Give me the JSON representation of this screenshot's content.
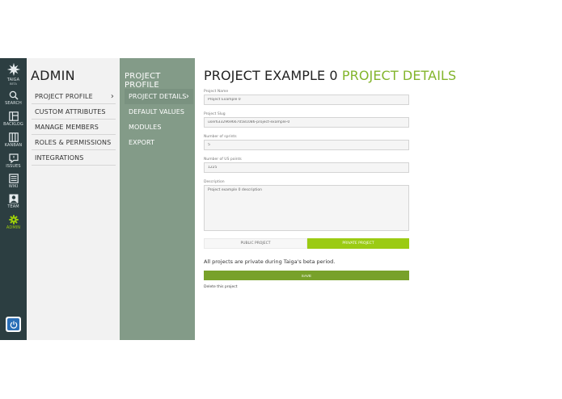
{
  "nav": {
    "brand": "TAIGA",
    "brand_sub": "BETA",
    "items": [
      {
        "label": "SEARCH",
        "icon": "search-icon"
      },
      {
        "label": "BACKLOG",
        "icon": "backlog-icon"
      },
      {
        "label": "KANBAN",
        "icon": "kanban-icon"
      },
      {
        "label": "ISSUES",
        "icon": "issues-icon"
      },
      {
        "label": "WIKI",
        "icon": "wiki-icon"
      },
      {
        "label": "TEAM",
        "icon": "team-icon"
      },
      {
        "label": "ADMIN",
        "icon": "gear-icon"
      }
    ]
  },
  "admin": {
    "title": "ADMIN",
    "items": [
      {
        "label": "PROJECT PROFILE"
      },
      {
        "label": "CUSTOM ATTRIBUTES"
      },
      {
        "label": "MANAGE MEMBERS"
      },
      {
        "label": "ROLES & PERMISSIONS"
      },
      {
        "label": "INTEGRATIONS"
      }
    ]
  },
  "profile": {
    "title": "PROJECT PROFILE",
    "items": [
      {
        "label": "PROJECT DETAILS"
      },
      {
        "label": "DEFAULT VALUES"
      },
      {
        "label": "MODULES"
      },
      {
        "label": "EXPORT"
      }
    ]
  },
  "main": {
    "project_name": "PROJECT EXAMPLE 0",
    "section_title": "PROJECT DETAILS",
    "fields": {
      "name": {
        "label": "Project Name",
        "value": "Project Example 0"
      },
      "slug": {
        "label": "Project Slug",
        "value": "user63329696670581086-project-example-0"
      },
      "sprints": {
        "label": "Number of sprints",
        "value": "5"
      },
      "points": {
        "label": "Number of US points",
        "value": "1225"
      },
      "description": {
        "label": "Description",
        "value": "Project example 0 description"
      }
    },
    "privacy": {
      "public_label": "PUBLIC PROJECT",
      "private_label": "PRIVATE PROJECT"
    },
    "beta_note": "All projects are private during Taiga's beta period.",
    "save_label": "SAVE",
    "delete_label": "Delete this project"
  },
  "colors": {
    "rail": "#2c3e41",
    "accent": "#9dce0a",
    "section_green": "#83b52c",
    "profile_bg": "#839b88",
    "save_green": "#78a12a"
  }
}
